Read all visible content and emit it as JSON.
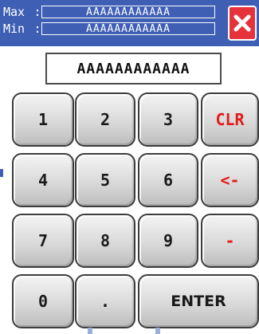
{
  "header": {
    "max_label": "Max",
    "min_label": "Min",
    "separator": ":",
    "max_value": "AAAAAAAAAAAA",
    "min_value": "AAAAAAAAAAAA",
    "close_icon": "close-x-icon"
  },
  "display": {
    "value": "AAAAAAAAAAAA"
  },
  "keys": {
    "k1": "1",
    "k2": "2",
    "k3": "3",
    "clr": "CLR",
    "k4": "4",
    "k5": "5",
    "k6": "6",
    "backspace": "<-",
    "k7": "7",
    "k8": "8",
    "k9": "9",
    "minus": "-",
    "k0": "0",
    "dot": ".",
    "enter": "ENTER"
  },
  "colors": {
    "header_bg": "#3f5fb4",
    "close_bg": "#e6323a",
    "accent_red": "#e41b1b"
  }
}
